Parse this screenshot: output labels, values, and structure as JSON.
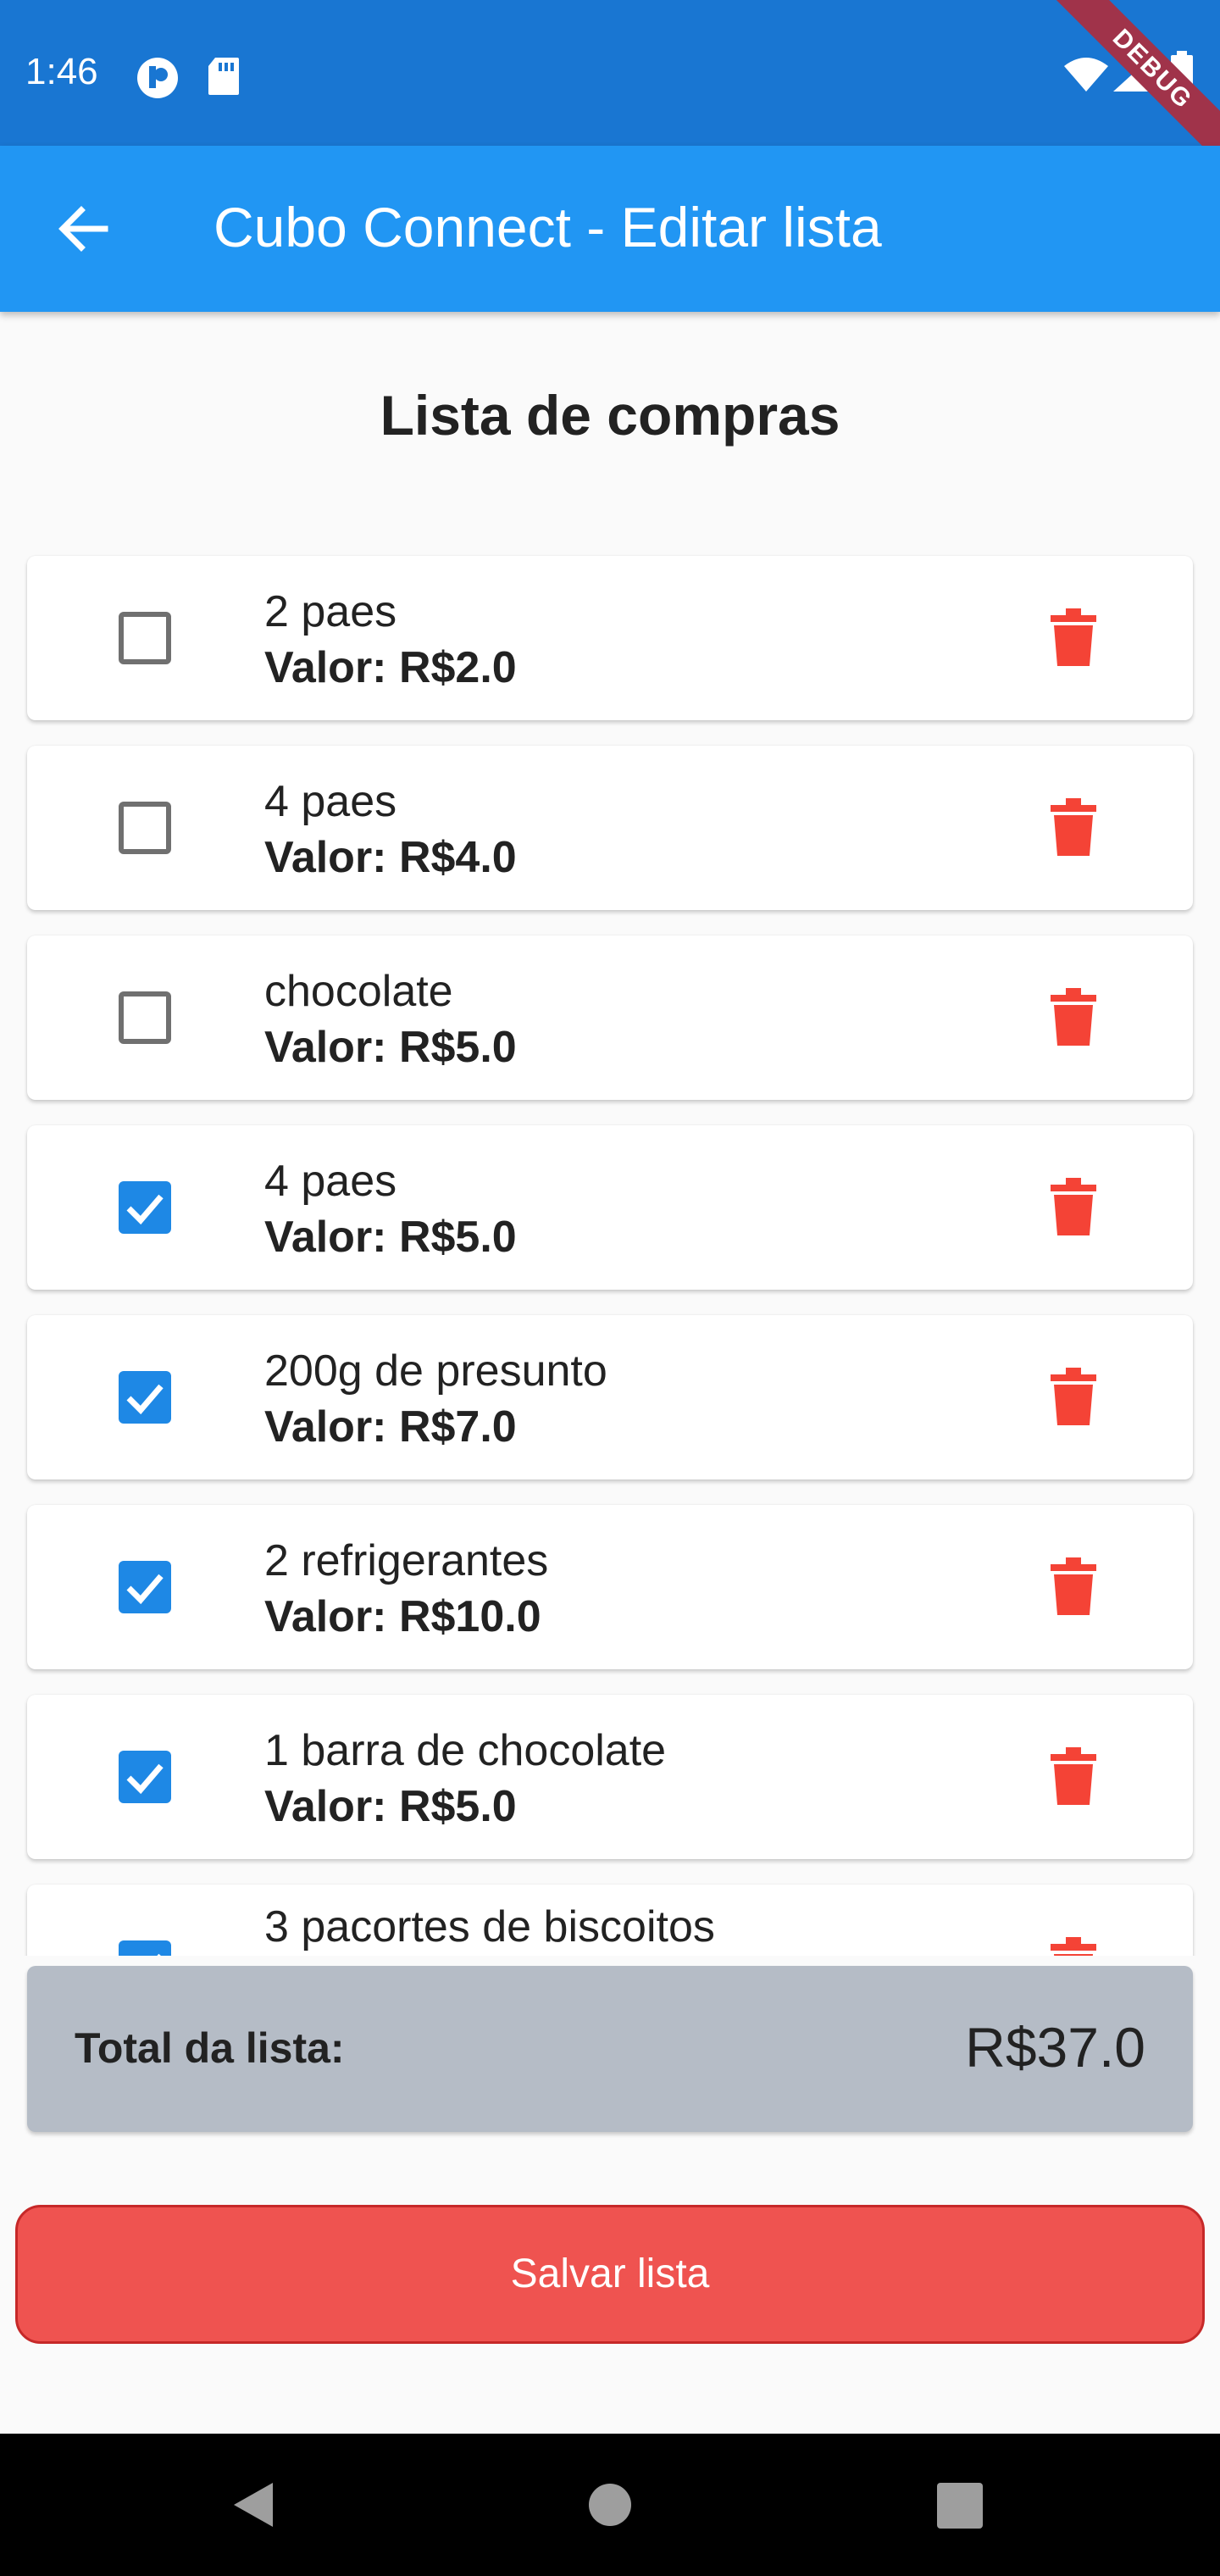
{
  "status_bar": {
    "time": "1:46",
    "debug_label": "DEBUG"
  },
  "app_bar": {
    "title": "Cubo Connect - Editar lista"
  },
  "page": {
    "heading": "Lista de compras"
  },
  "items": [
    {
      "name": "2 paes",
      "value": "Valor: R$2.0",
      "checked": false
    },
    {
      "name": "4 paes",
      "value": "Valor: R$4.0",
      "checked": false
    },
    {
      "name": "chocolate",
      "value": "Valor: R$5.0",
      "checked": false
    },
    {
      "name": "4 paes",
      "value": "Valor: R$5.0",
      "checked": true
    },
    {
      "name": "200g de presunto",
      "value": "Valor: R$7.0",
      "checked": true
    },
    {
      "name": "2 refrigerantes",
      "value": "Valor: R$10.0",
      "checked": true
    },
    {
      "name": "1 barra de chocolate",
      "value": "Valor: R$5.0",
      "checked": true
    },
    {
      "name": "3 pacortes de biscoitos",
      "value": "",
      "checked": true
    }
  ],
  "total": {
    "label": "Total da lista:",
    "value": "R$37.0"
  },
  "save_button": {
    "label": "Salvar lista"
  },
  "colors": {
    "status_bar": "#1976d2",
    "app_bar": "#2196f3",
    "accent": "#1e88e5",
    "danger": "#f44336",
    "save": "#ef5350"
  }
}
